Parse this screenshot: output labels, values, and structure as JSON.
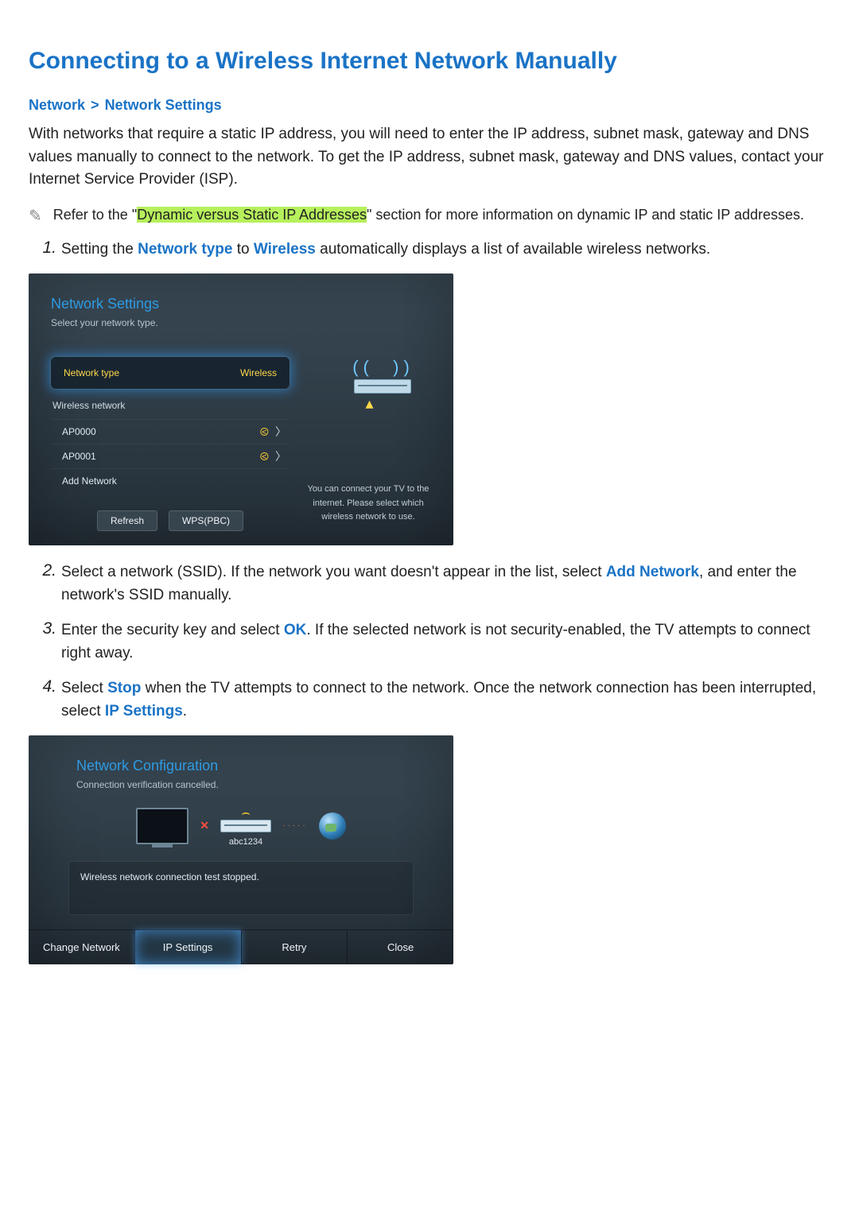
{
  "page": {
    "title": "Connecting to a Wireless Internet Network Manually",
    "breadcrumb": {
      "a": "Network",
      "sep": ">",
      "b": "Network Settings"
    },
    "intro": "With networks that require a static IP address, you will need to enter the IP address, subnet mask, gateway and DNS values manually to connect to the network. To get the IP address, subnet mask, gateway and DNS values, contact your Internet Service Provider (ISP).",
    "note": {
      "pre": "Refer to the \"",
      "hl": "Dynamic versus Static IP Addresses",
      "post": "\" section for more information on dynamic IP and static IP addresses."
    }
  },
  "steps": {
    "s1": {
      "num": "1.",
      "pre": "Setting the ",
      "link1": "Network type",
      "mid": " to ",
      "link2": "Wireless",
      "post": " automatically displays a list of available wireless networks."
    },
    "s2": {
      "num": "2.",
      "pre": "Select a network (SSID). If the network you want doesn't appear in the list, select ",
      "link1": "Add Network",
      "post": ", and enter the network's SSID manually."
    },
    "s3": {
      "num": "3.",
      "pre": "Enter the security key and select ",
      "link1": "OK",
      "post": ". If the selected network is not security-enabled, the TV attempts to connect right away."
    },
    "s4": {
      "num": "4.",
      "pre": "Select ",
      "link1": "Stop",
      "mid": " when the TV attempts to connect to the network. Once the network connection has been interrupted, select ",
      "link2": "IP Settings",
      "post": "."
    }
  },
  "panel1": {
    "title": "Network Settings",
    "subtitle": "Select your network type.",
    "network_type_label": "Network type",
    "network_type_value": "Wireless",
    "wireless_header": "Wireless network",
    "networks": [
      {
        "name": "AP0000"
      },
      {
        "name": "AP0001"
      }
    ],
    "add_network": "Add Network",
    "btn_refresh": "Refresh",
    "btn_wps": "WPS(PBC)",
    "hint": "You can connect your TV to the internet. Please select which wireless network to use."
  },
  "panel2": {
    "title": "Network Configuration",
    "subtitle": "Connection verification cancelled.",
    "ap_label": "abc1234",
    "status": "Wireless network connection test stopped.",
    "btn_change": "Change Network",
    "btn_ip": "IP Settings",
    "btn_retry": "Retry",
    "btn_close": "Close"
  }
}
